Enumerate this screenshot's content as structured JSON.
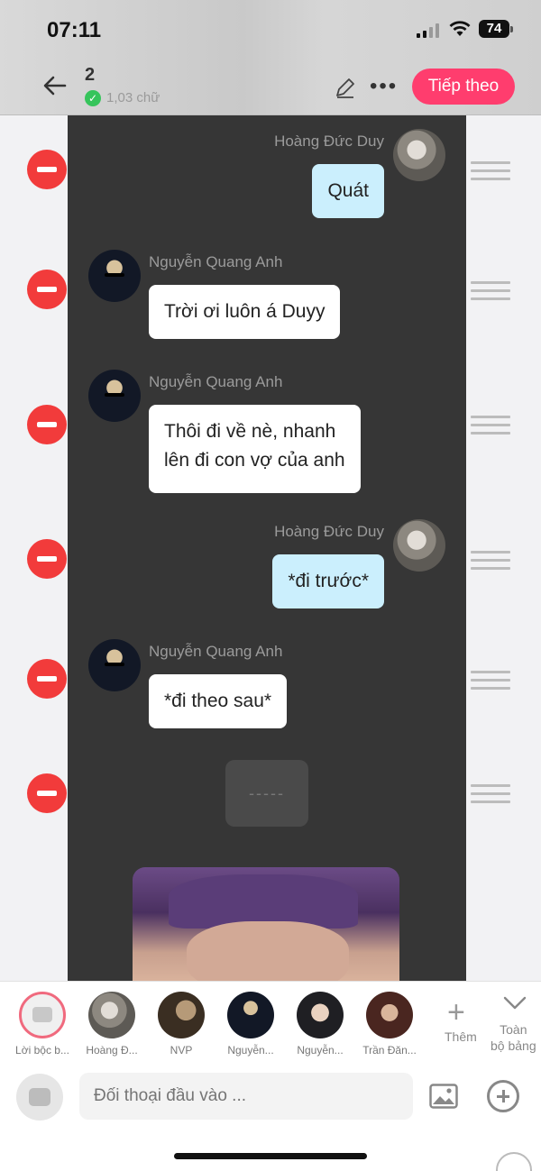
{
  "status_bar": {
    "time": "07:11",
    "battery": "74"
  },
  "header": {
    "count": "2",
    "subtitle": "1,03 chữ",
    "next_label": "Tiếp theo"
  },
  "messages": [
    {
      "speaker": "Hoàng Đức Duy",
      "text": "Quát",
      "side": "right"
    },
    {
      "speaker": "Nguyễn Quang Anh",
      "text": "Trời ơi luôn á Duyy",
      "side": "left"
    },
    {
      "speaker": "Nguyễn Quang Anh",
      "text_line1": "Thôi đi về nè, nhanh",
      "text_line2": "lên đi con vợ của anh",
      "side": "left"
    },
    {
      "speaker": "Hoàng Đức Duy",
      "text": "*đi trước*",
      "side": "right"
    },
    {
      "speaker": "Nguyễn Quang Anh",
      "text": "*đi theo sau*",
      "side": "left"
    }
  ],
  "narration_placeholder": "-----",
  "characters": [
    {
      "label": "Lời bộc b..."
    },
    {
      "label": "Hoàng Đ..."
    },
    {
      "label": "NVP"
    },
    {
      "label": "Nguyễn..."
    },
    {
      "label": "Nguyễn..."
    },
    {
      "label": "Trần Đăn..."
    }
  ],
  "bottom": {
    "add_label": "Thêm",
    "all_label_1": "Toàn",
    "all_label_2": "bộ bảng",
    "input_placeholder": "Đối thoại đầu vào ..."
  },
  "colors": {
    "accent": "#ff3d6e",
    "delete": "#f23b3b",
    "me_bubble": "#cbeffd",
    "panel": "#363636"
  },
  "icons": [
    "back-arrow-icon",
    "pencil-icon",
    "more-icon",
    "remove-icon",
    "drag-handle-icon",
    "plus-icon",
    "chevron-down-icon",
    "image-icon",
    "add-circle-icon",
    "scroll-up-icon"
  ]
}
